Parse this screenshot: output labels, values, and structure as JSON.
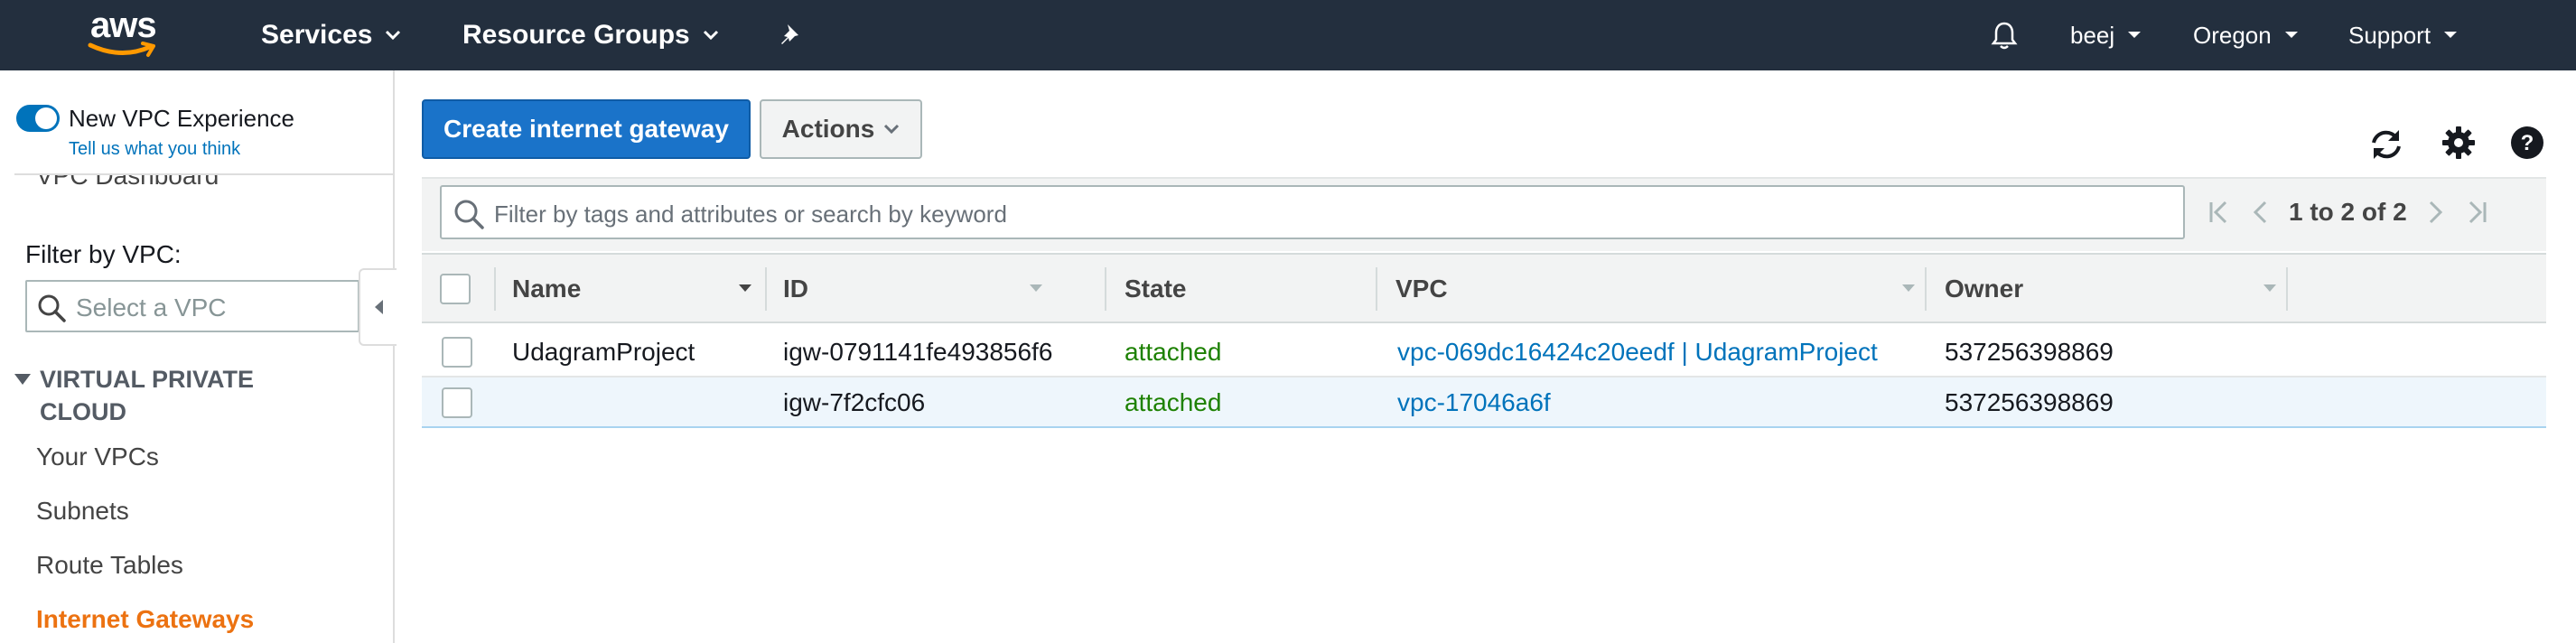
{
  "colors": {
    "nav_bg": "#232f3e",
    "primary_button": "#1a73c9",
    "link": "#0073bb",
    "active_nav": "#ec7211",
    "state_attached": "#1d8102"
  },
  "topnav": {
    "logo_text": "aws",
    "services_label": "Services",
    "resource_groups_label": "Resource Groups",
    "pin_icon": "pin-icon",
    "bell_icon": "bell-icon",
    "user_label": "beej",
    "region_label": "Oregon",
    "support_label": "Support"
  },
  "sidebar": {
    "new_vpc_experience_label": "New VPC Experience",
    "new_vpc_experience_enabled": true,
    "feedback_link": "Tell us what you think",
    "dashboard_label": "VPC Dashboard",
    "filter_label": "Filter by VPC:",
    "filter_placeholder": "Select a VPC",
    "section_title_line1": "VIRTUAL PRIVATE",
    "section_title_line2": "CLOUD",
    "items": [
      {
        "label": "Your VPCs",
        "active": false
      },
      {
        "label": "Subnets",
        "active": false
      },
      {
        "label": "Route Tables",
        "active": false
      },
      {
        "label": "Internet Gateways",
        "active": true
      }
    ]
  },
  "toolbar": {
    "create_label": "Create internet gateway",
    "actions_label": "Actions",
    "refresh_icon": "refresh-icon",
    "settings_icon": "gear-icon",
    "help_icon": "help-icon"
  },
  "search": {
    "placeholder": "Filter by tags and attributes or search by keyword"
  },
  "pagination": {
    "text": "1 to 2 of 2"
  },
  "table": {
    "columns": [
      "Name",
      "ID",
      "State",
      "VPC",
      "Owner"
    ],
    "rows": [
      {
        "name": "UdagramProject",
        "id": "igw-0791141fe493856f6",
        "state": "attached",
        "vpc": "vpc-069dc16424c20eedf | UdagramProject",
        "owner": "537256398869",
        "selected": false
      },
      {
        "name": "",
        "id": "igw-7f2cfc06",
        "state": "attached",
        "vpc": "vpc-17046a6f",
        "owner": "537256398869",
        "selected": true
      }
    ]
  }
}
